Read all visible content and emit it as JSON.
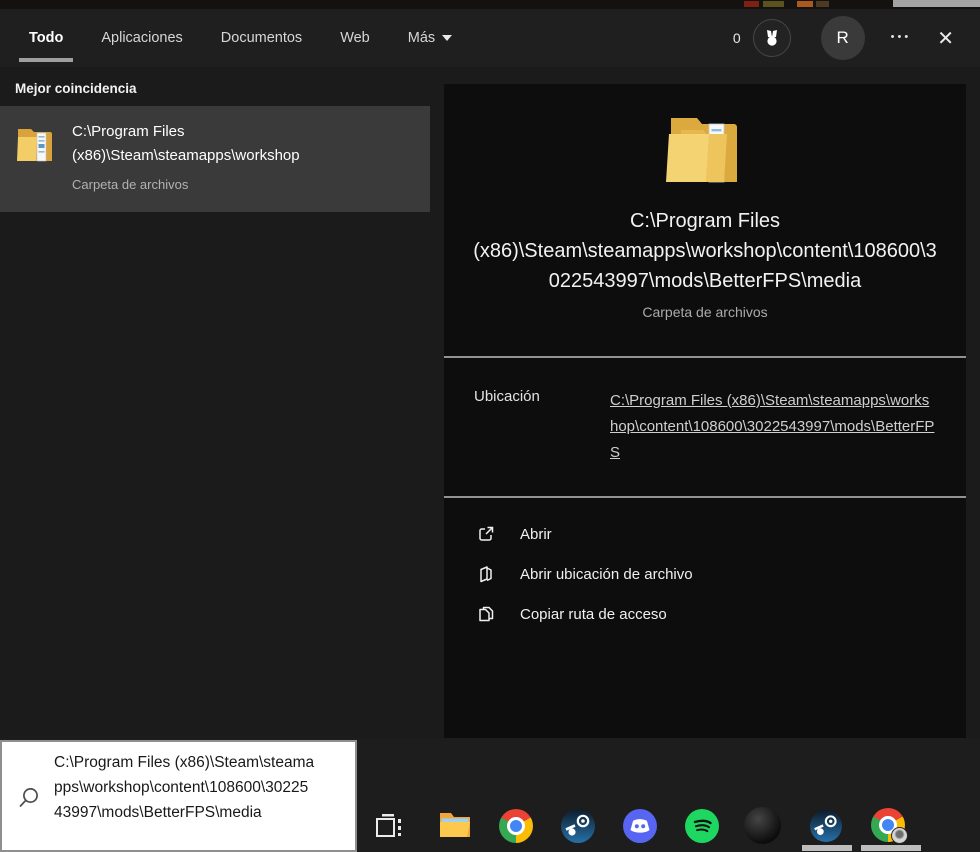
{
  "topbar": {
    "tabs": [
      {
        "label": "Todo",
        "selected": true
      },
      {
        "label": "Aplicaciones",
        "selected": false
      },
      {
        "label": "Documentos",
        "selected": false
      },
      {
        "label": "Web",
        "selected": false
      },
      {
        "label": "Más",
        "selected": false,
        "has_dropdown": true
      }
    ],
    "rewards_count": "0",
    "avatar_letter": "R",
    "ellipsis_glyph": "•••",
    "close_glyph": "✕"
  },
  "results": {
    "section_title": "Mejor coincidencia",
    "best_match": {
      "title": "C:\\Program Files (x86)\\Steam\\steamapps\\workshop",
      "subtitle": "Carpeta de archivos",
      "icon": "folder-icon"
    }
  },
  "preview": {
    "title": "C:\\Program Files (x86)\\Steam\\steamapps\\workshop\\content\\108600\\3022543997\\mods\\BetterFPS\\media",
    "subtitle": "Carpeta de archivos",
    "icon": "folder-icon",
    "location_label": "Ubicación",
    "location_link": "C:\\Program Files (x86)\\Steam\\steamapps\\workshop\\content\\108600\\3022543997\\mods\\BetterFPS",
    "actions": [
      {
        "label": "Abrir",
        "icon": "open-external-icon"
      },
      {
        "label": "Abrir ubicación de archivo",
        "icon": "open-file-location-icon"
      },
      {
        "label": "Copiar ruta de acceso",
        "icon": "copy-icon"
      }
    ]
  },
  "search": {
    "value": "C:\\Program Files (x86)\\Steam\\steamapps\\workshop\\content\\108600\\3022543997\\mods\\BetterFPS\\media",
    "icon": "search-icon"
  },
  "taskbar": {
    "icons": [
      "task-view",
      "file-explorer",
      "chrome",
      "steam",
      "discord",
      "spotify",
      "dark-app",
      "steam",
      "chrome-profile"
    ],
    "running_indicator_count": 2
  },
  "colors": {
    "flyout_bg": "#1b1b1b",
    "tabbar_bg": "#1f1f1f",
    "selected_item_bg": "#3a3a3a",
    "preview_card_bg": "#0d0d0d",
    "search_box_bg": "#ffffff",
    "link_color": "#cfcfcf",
    "divider_color": "#929292",
    "discord_brand": "#5865f2",
    "spotify_brand": "#1ed760"
  }
}
